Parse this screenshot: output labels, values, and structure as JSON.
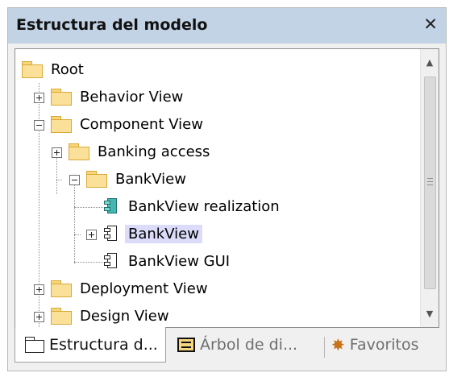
{
  "panel": {
    "title": "Estructura del modelo",
    "close_glyph": "✕"
  },
  "tree": {
    "root": "Root",
    "items": [
      {
        "label": "Behavior View",
        "type": "folder",
        "expander": "plus"
      },
      {
        "label": "Component View",
        "type": "folder",
        "expander": "minus"
      },
      {
        "label": "Banking access",
        "type": "folder",
        "expander": "plus"
      },
      {
        "label": "BankView",
        "type": "folder",
        "expander": "minus"
      },
      {
        "label": "BankView realization",
        "type": "realization-component"
      },
      {
        "label": "BankView",
        "type": "component",
        "expander": "plus",
        "selected": true
      },
      {
        "label": "BankView GUI",
        "type": "component"
      },
      {
        "label": "Deployment View",
        "type": "folder",
        "expander": "plus"
      },
      {
        "label": "Design View",
        "type": "folder",
        "expander": "plus"
      }
    ]
  },
  "tabs": [
    {
      "label": "Estructura d...",
      "icon": "folder-icon",
      "active": true
    },
    {
      "label": "Árbol de di...",
      "icon": "diagram-tree-icon",
      "active": false
    },
    {
      "label": "Favoritos",
      "icon": "favorites-icon",
      "active": false
    }
  ],
  "colors": {
    "title_bar": "#c3d3e6",
    "selection": "#dcdcfa",
    "folder": "#fbe09a"
  }
}
